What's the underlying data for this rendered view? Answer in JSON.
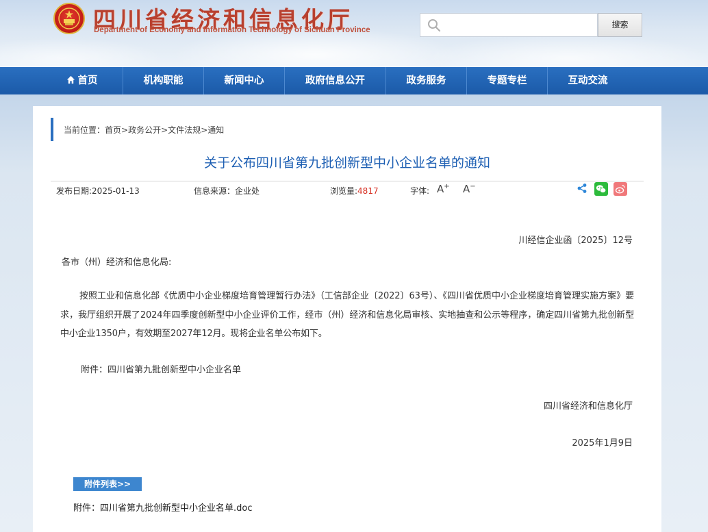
{
  "header": {
    "title": "四川省经济和信息化厅",
    "subtitle": "Department of Economy and Information Technology of Sichuan Province",
    "search_placeholder": "",
    "search_button": "搜索",
    "emblem_icon": "national-emblem-icon",
    "brand_color": "#b8402f"
  },
  "nav": {
    "items": [
      {
        "label": "首页",
        "icon": "home-icon"
      },
      {
        "label": "机构职能"
      },
      {
        "label": "新闻中心"
      },
      {
        "label": "政府信息公开"
      },
      {
        "label": "政务服务"
      },
      {
        "label": "专题专栏"
      },
      {
        "label": "互动交流"
      }
    ],
    "bg_color": "#1f62b4"
  },
  "breadcrumb": {
    "prefix": "当前位置：",
    "items": [
      "首页",
      "政务公开",
      "文件法规",
      "通知"
    ],
    "separator": ">"
  },
  "article": {
    "title": "关于公布四川省第九批创新型中小企业名单的通知",
    "meta": {
      "date_label": "发布日期:2025-01-13",
      "source_label": "信息来源：企业处",
      "views_label": "浏览量:",
      "views": "4817",
      "font_label": "字体:",
      "font_increase": "A",
      "font_decrease": "A"
    },
    "doc_number": "川经信企业函〔2025〕12号",
    "salutation": "各市（州）经济和信息化局:",
    "body": "按照工业和信息化部《优质中小企业梯度培育管理暂行办法》（工信部企业〔2022〕63号）、《四川省优质中小企业梯度培育管理实施方案》要求，我厅组织开展了2024年四季度创新型中小企业评价工作，经市（州）经济和信息化局审核、实地抽查和公示等程序，确定四川省第九批创新型中小企业1350户，有效期至2027年12月。现将企业名单公布如下。",
    "attachment": "附件：四川省第九批创新型中小企业名单",
    "signature": "四川省经济和信息化厅",
    "date": "2025年1月9日",
    "attachments_tab": "附件列表>>",
    "file_prefix": "附件：",
    "file_name": "四川省第九批创新型中小企业名单.doc",
    "views_color": "#d62c1f",
    "title_color": "#1d5fb3"
  },
  "share": {
    "share_icon": "share-icon",
    "wechat_icon": "wechat-icon",
    "weibo_icon": "weibo-icon"
  }
}
